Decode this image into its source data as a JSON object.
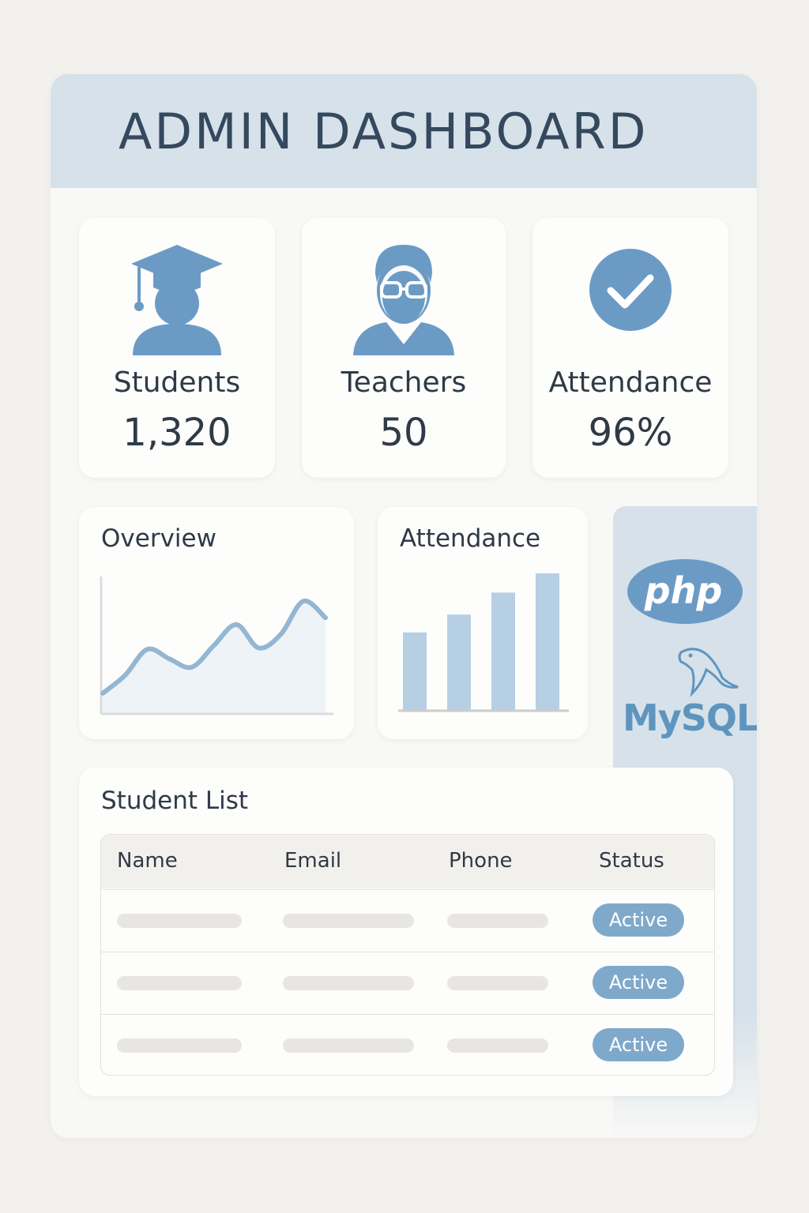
{
  "header": {
    "title": "ADMIN DASHBOARD"
  },
  "stats": [
    {
      "label": "Students",
      "value": "1,320",
      "icon": "graduate-icon"
    },
    {
      "label": "Teachers",
      "value": "50",
      "icon": "teacher-icon"
    },
    {
      "label": "Attendance",
      "value": "96%",
      "icon": "check-circle-icon"
    }
  ],
  "overview": {
    "title": "Overview"
  },
  "attendance_chart": {
    "title": "Attendance"
  },
  "tech": {
    "php_label": "php",
    "mysql_label": "MySQL"
  },
  "student_list": {
    "title": "Student List",
    "columns": [
      "Name",
      "Email",
      "Phone",
      "Status"
    ],
    "rows": [
      {
        "status": "Active"
      },
      {
        "status": "Active"
      },
      {
        "status": "Active"
      }
    ]
  },
  "colors": {
    "accent": "#6b9bc5",
    "header_bg": "#d6e1ea",
    "badge": "#7fa9cb"
  },
  "chart_data": [
    {
      "type": "area",
      "title": "Overview",
      "x": [
        0,
        1,
        2,
        3,
        4,
        5,
        6,
        7,
        8,
        9,
        10
      ],
      "values": [
        15,
        28,
        47,
        40,
        34,
        50,
        65,
        48,
        58,
        82,
        70
      ],
      "ylim": [
        0,
        100
      ]
    },
    {
      "type": "bar",
      "title": "Attendance",
      "categories": [
        "1",
        "2",
        "3",
        "4"
      ],
      "values": [
        57,
        70,
        86,
        100
      ],
      "ylim": [
        0,
        100
      ]
    }
  ]
}
